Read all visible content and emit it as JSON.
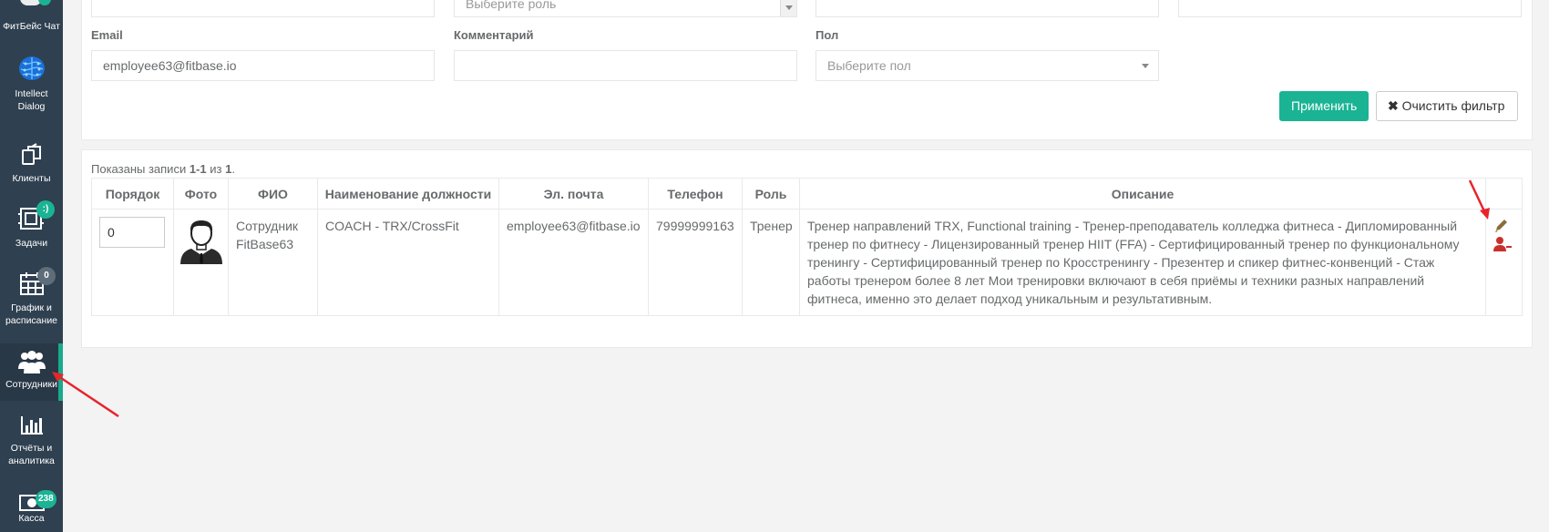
{
  "sidebar": {
    "items": [
      {
        "label": "ФитБейс Чат"
      },
      {
        "label_line1": "Intellect",
        "label_line2": "Dialog"
      },
      {
        "label": "Клиенты"
      },
      {
        "label": "Задачи",
        "badge": ":)"
      },
      {
        "label_line1": "График и",
        "label_line2": "расписание",
        "badge": "0"
      },
      {
        "label": "Сотрудники"
      },
      {
        "label_line1": "Отчёты и",
        "label_line2": "аналитика"
      },
      {
        "label": "Касса",
        "badge": "238"
      }
    ]
  },
  "filter": {
    "role_placeholder": "Выберите роль",
    "email_label": "Email",
    "email_value": "employee63@fitbase.io",
    "comment_label": "Комментарий",
    "comment_value": "",
    "gender_label": "Пол",
    "gender_placeholder": "Выберите пол",
    "apply_label": "Применить",
    "clear_label": "Очистить фильтр"
  },
  "summary": {
    "prefix": "Показаны записи ",
    "range": "1-1",
    "middle": " из ",
    "total": "1",
    "suffix": "."
  },
  "table": {
    "headers": [
      "Порядок",
      "Фото",
      "ФИО",
      "Наименование должности",
      "Эл. почта",
      "Телефон",
      "Роль",
      "Описание"
    ],
    "rows": [
      {
        "order": "0",
        "name": "Сотрудник FitBase63",
        "position": "COACH - TRX/CrossFit",
        "email": "employee63@fitbase.io",
        "phone": "79999999163",
        "role": "Тренер",
        "description": "Тренер направлений TRX, Functional training - Тренер-преподаватель колледжа фитнеса - Дипломированный тренер по фитнесу - Лицензированный тренер HIIT (FFA) - Сертифицированный тренер по функциональному тренингу - Сертифицированный тренер по Кросстренингу - Презентер и спикер фитнес-конвенций - Стаж работы тренером более 8 лет Мои тренировки включают в себя приёмы и техники разных направлений фитнеса, именно это делает подход уникальным и результативным."
      }
    ]
  },
  "colors": {
    "sidebar_bg": "#2f4050",
    "accent": "#1ab394",
    "edit_icon": "#8a6d3b",
    "remove_icon": "#c9302c",
    "annotation_arrow": "#e8242b"
  }
}
